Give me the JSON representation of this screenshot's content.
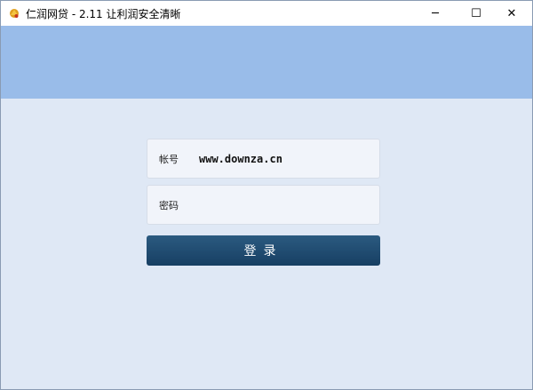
{
  "window": {
    "title": "仁润网贷 - 2.11 让利润安全清晰",
    "icon": "app-logo-icon",
    "controls": {
      "minimize": "─",
      "maximize": "☐",
      "close": "✕"
    }
  },
  "login": {
    "account_label": "帐号",
    "account_value": "www.downza.cn",
    "password_label": "密码",
    "password_value": "",
    "submit_label": "登录"
  },
  "colors": {
    "banner": "#99bce9",
    "background": "#dfe8f5",
    "button": "#1e4a70"
  }
}
